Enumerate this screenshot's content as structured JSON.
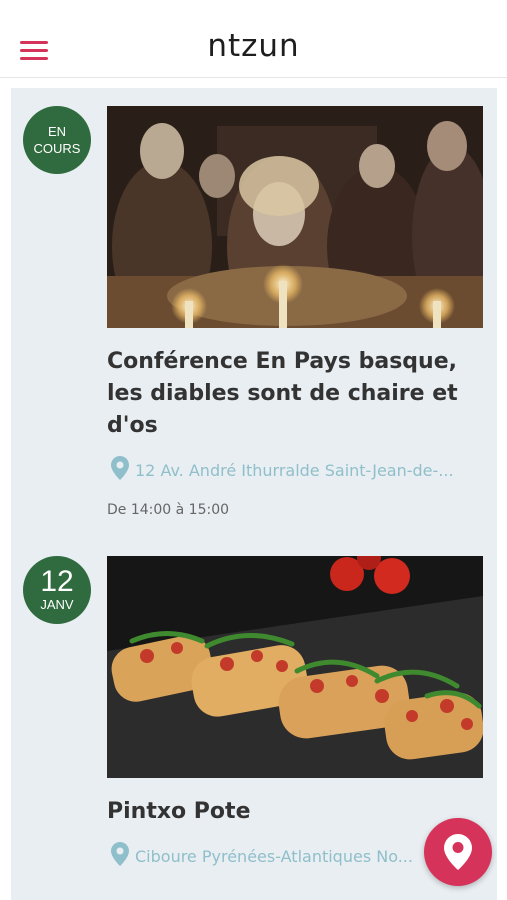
{
  "app": {
    "logo": "ntzun"
  },
  "header": {
    "menu_icon": "hamburger-menu-icon"
  },
  "events": [
    {
      "badge_label": "EN COURS",
      "title": "Conférence En Pays basque, les diables sont de chaire et d'os",
      "location": "12 Av. André Ithurralde Saint-Jean-de-...",
      "time": "De 14:00 à 15:00"
    },
    {
      "badge_day": "12",
      "badge_month": "JANV",
      "title": "Pintxo Pote",
      "location": "Ciboure Pyrénées-Atlantiques No..."
    }
  ],
  "colors": {
    "accent": "#d6335a",
    "badge": "#2f6b3e",
    "location": "#8fbfca",
    "feed_bg": "#e9eef2"
  },
  "fab": {
    "icon": "map-pin-icon"
  }
}
